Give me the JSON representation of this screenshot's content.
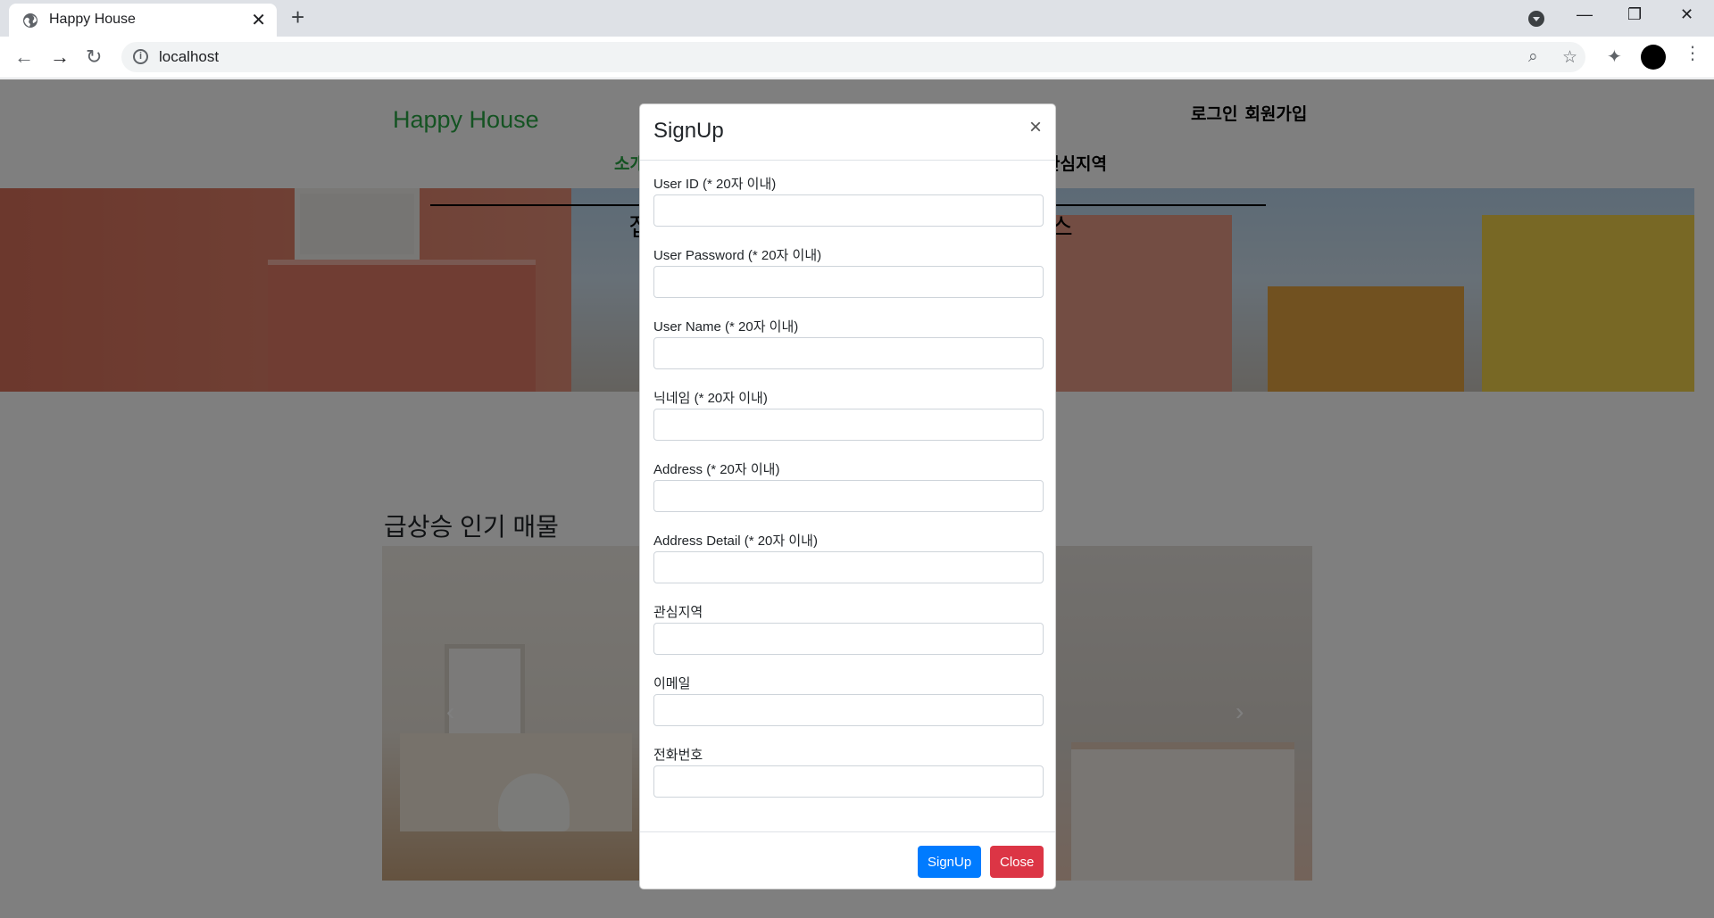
{
  "browser": {
    "tab_title": "Happy House",
    "tab_close": "✕",
    "new_tab": "+",
    "url": "localhost",
    "back": "←",
    "forward": "→",
    "reload": "↻",
    "minimize": "—",
    "restore": "❐",
    "close": "✕",
    "zoom": "⌕",
    "star": "☆",
    "extensions": "✦",
    "menu": "⋮"
  },
  "site": {
    "logo": "Happy House",
    "login": "로그인",
    "signup_link": "회원가입",
    "nav_left": "소개",
    "nav_right": "관심지역",
    "hero_left": "집",
    "hero_right": "스",
    "section_title": "급상승 인기 매물",
    "prev_arrow": "‹",
    "next_arrow": "›"
  },
  "modal": {
    "title": "SignUp",
    "close": "×",
    "fields": [
      {
        "label": "User ID (* 20자 이내)",
        "value": ""
      },
      {
        "label": "User Password (* 20자 이내)",
        "value": ""
      },
      {
        "label": "User Name (* 20자 이내)",
        "value": ""
      },
      {
        "label": "닉네임 (* 20자 이내)",
        "value": ""
      },
      {
        "label": "Address (* 20자 이내)",
        "value": ""
      },
      {
        "label": "Address Detail (* 20자 이내)",
        "value": ""
      },
      {
        "label": "관심지역",
        "value": ""
      },
      {
        "label": "이메일",
        "value": ""
      },
      {
        "label": "전화번호",
        "value": ""
      }
    ],
    "signup_button": "SignUp",
    "close_button": "Close"
  },
  "colors": {
    "brand_green": "#28a745",
    "primary": "#007bff",
    "danger": "#dc3545"
  }
}
